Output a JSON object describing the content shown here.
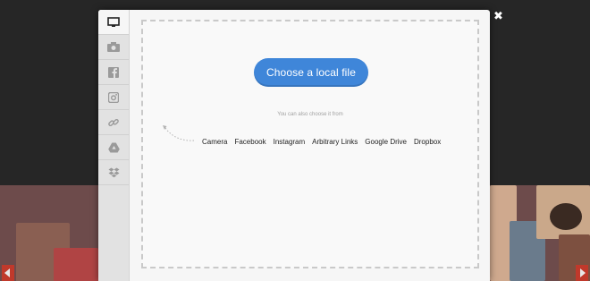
{
  "modal": {
    "choose_button": "Choose a local file",
    "hint": "You can also choose it from",
    "sources": [
      "Camera",
      "Facebook",
      "Instagram",
      "Arbitrary Links",
      "Google Drive",
      "Dropbox"
    ]
  },
  "sidebar": {
    "items": [
      {
        "icon": "monitor-icon",
        "active": true
      },
      {
        "icon": "camera-icon",
        "active": false
      },
      {
        "icon": "facebook-icon",
        "active": false
      },
      {
        "icon": "instagram-icon",
        "active": false
      },
      {
        "icon": "link-icon",
        "active": false
      },
      {
        "icon": "google-drive-icon",
        "active": false
      },
      {
        "icon": "dropbox-icon",
        "active": false
      }
    ]
  },
  "colors": {
    "accent": "#3f86d9",
    "overlay": "#262626",
    "nav_arrow": "#c0392b"
  },
  "close_glyph": "✖"
}
